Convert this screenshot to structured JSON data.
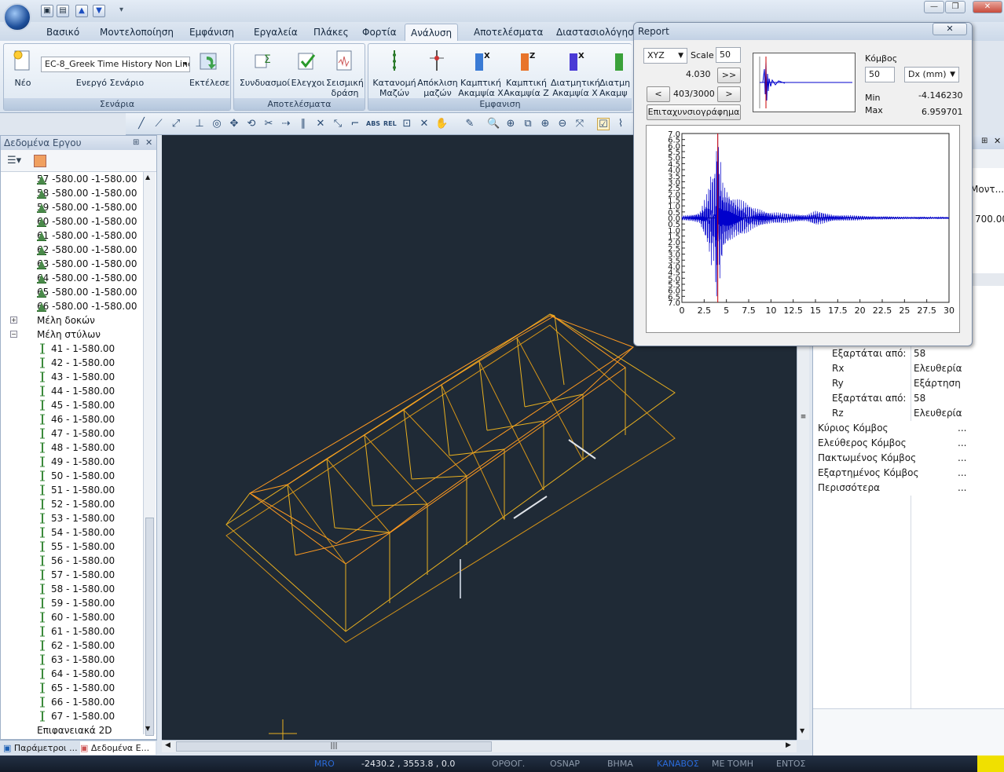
{
  "quick_access": {
    "icons": [
      "save-icon",
      "open-icon",
      "up-icon",
      "down-icon"
    ]
  },
  "window_controls": {
    "minimize": "—",
    "maximize": "❐",
    "close": "✕"
  },
  "tabs": [
    "Βασικό",
    "Μοντελοποίηση",
    "Εμφάνιση",
    "Εργαλεία",
    "Πλάκες",
    "Φορτία",
    "Ανάλυση",
    "Αποτελέσματα",
    "Διαστασιολόγηση"
  ],
  "active_tab": "Ανάλυση",
  "ribbon": {
    "scenario_group": {
      "caption": "Σενάρια",
      "new_label": "Νέο",
      "scenario_select": "EC-8_Greek Time History Non Line",
      "scenario_caption": "Ενεργό Σενάριο",
      "run_label": "Εκτέλεσε"
    },
    "results_group": {
      "caption": "Αποτελέσματα",
      "combos_label": "Συνδυασμοί",
      "checks_label": "Ελεγχοι",
      "seismic_label_1": "Σεισμική",
      "seismic_label_2": "δράση"
    },
    "display_group": {
      "caption": "Εμφανιση",
      "mass_dist_1": "Κατανομή",
      "mass_dist_2": "Μαζών",
      "mass_ecc_1": "Απόκλιση",
      "mass_ecc_2": "μαζών",
      "bend_x_1": "Καμπτική",
      "bend_x_2": "Ακαμψία X",
      "bend_z_1": "Καμπτική",
      "bend_z_2": "Ακαμψία Z",
      "shear_x_1": "Διατμητική",
      "shear_x_2": "Ακαμψία X",
      "shear_z_1": "Διατμη",
      "shear_z_2": "Ακαμψ"
    }
  },
  "left_panel": {
    "title": "Δεδομένα Εργου",
    "nodes": [
      "57 -580.00 -1-580.00",
      "58 -580.00 -1-580.00",
      "59 -580.00 -1-580.00",
      "60 -580.00 -1-580.00",
      "61 -580.00 -1-580.00",
      "62 -580.00 -1-580.00",
      "63 -580.00 -1-580.00",
      "64 -580.00 -1-580.00",
      "65 -580.00 -1-580.00",
      "66 -580.00 -1-580.00"
    ],
    "beams_label": "Μέλη δοκών",
    "columns_label": "Μέλη στύλων",
    "columns": [
      "41 - 1-580.00",
      "42 - 1-580.00",
      "43 - 1-580.00",
      "44 - 1-580.00",
      "45 - 1-580.00",
      "46 - 1-580.00",
      "47 - 1-580.00",
      "48 - 1-580.00",
      "49 - 1-580.00",
      "50 - 1-580.00",
      "51 - 1-580.00",
      "52 - 1-580.00",
      "53 - 1-580.00",
      "54 - 1-580.00",
      "55 - 1-580.00",
      "56 - 1-580.00",
      "57 - 1-580.00",
      "58 - 1-580.00",
      "59 - 1-580.00",
      "60 - 1-580.00",
      "61 - 1-580.00",
      "62 - 1-580.00",
      "63 - 1-580.00",
      "64 - 1-580.00",
      "65 - 1-580.00",
      "66 - 1-580.00",
      "67 - 1-580.00"
    ],
    "surfaces_label": "Επιφανειακά 2D"
  },
  "bottom_tabs": [
    "Παράμετροι ...",
    "Δεδομένα Ε..."
  ],
  "right_panel": {
    "partial_top_1": "Μοντ...",
    "partial_top_2": "700.00",
    "rows": [
      {
        "k": "Εξαρτάται από:",
        "v": "58",
        "indent": true
      },
      {
        "k": "Rx",
        "v": "Ελευθερία",
        "indent": true
      },
      {
        "k": "Ry",
        "v": "Εξάρτηση",
        "indent": true
      },
      {
        "k": "Εξαρτάται από:",
        "v": "58",
        "indent": true
      },
      {
        "k": "Rz",
        "v": "Ελευθερία",
        "indent": true
      },
      {
        "k": "Κύριος Κόμβος",
        "v": "...",
        "indent": false
      },
      {
        "k": "Ελεύθερος Κόμβος",
        "v": "...",
        "indent": false
      },
      {
        "k": "Πακτωμένος Κόμβος",
        "v": "...",
        "indent": false
      },
      {
        "k": "Εξαρτημένος Κόμβος",
        "v": "...",
        "indent": false
      },
      {
        "k": "Περισσότερα",
        "v": "...",
        "indent": false
      }
    ]
  },
  "report": {
    "title": "Report",
    "close": "✕",
    "mode_select": "XYZ",
    "scale_label": "Scale",
    "scale_value": "50",
    "time_value": "4.030",
    "fast_forward": ">>",
    "prev": "<",
    "next": ">",
    "step_display": "403/3000",
    "accel_button": "Επιταχυνσιογράφημα",
    "node_label": "Κόμβος",
    "node_value": "50",
    "dof_select": "Dx (mm)",
    "min_label": "Min",
    "min_value": "-4.146230",
    "max_label": "Max",
    "max_value": "6.959701"
  },
  "chart_data": {
    "type": "line",
    "title": "",
    "xlabel": "",
    "ylabel": "",
    "xlim": [
      0,
      30
    ],
    "ylim": [
      -7.0,
      7.0
    ],
    "x_ticks": [
      "0",
      "2.5",
      "5",
      "7.5",
      "10",
      "12.5",
      "15",
      "17.5",
      "20",
      "22.5",
      "25",
      "27.5",
      "30"
    ],
    "y_ticks_pos": [
      "7.0",
      "6.5",
      "6.0",
      "5.5",
      "5.0",
      "4.5",
      "4.0",
      "3.5",
      "3.0",
      "2.5",
      "2.0",
      "1.5",
      "1.0",
      "0.5",
      "0.0"
    ],
    "y_ticks_neg": [
      "0.5",
      "1.0",
      "1.5",
      "2.0",
      "2.5",
      "3.0",
      "3.5",
      "4.0",
      "4.5",
      "5.0",
      "5.5",
      "6.0",
      "6.5",
      "7.0"
    ],
    "cursor_x": 4.03,
    "series": [
      {
        "values_envelope": [
          [
            0,
            0.2
          ],
          [
            1,
            0.3
          ],
          [
            2,
            0.5
          ],
          [
            2.5,
            1.5
          ],
          [
            3,
            2.5
          ],
          [
            3.3,
            4.0
          ],
          [
            3.6,
            -3.5
          ],
          [
            3.9,
            -6.5
          ],
          [
            4.03,
            6.96
          ],
          [
            4.3,
            -5.5
          ],
          [
            4.6,
            3.2
          ],
          [
            5,
            -2.8
          ],
          [
            6,
            1.8
          ],
          [
            7,
            -1.4
          ],
          [
            8,
            0.9
          ],
          [
            9,
            -0.8
          ],
          [
            10,
            0.5
          ],
          [
            12,
            -0.4
          ],
          [
            14,
            0.3
          ],
          [
            15,
            0.6
          ],
          [
            17,
            -0.3
          ],
          [
            20,
            0.2
          ],
          [
            22,
            -0.15
          ],
          [
            25,
            0.1
          ],
          [
            27,
            -0.1
          ],
          [
            30,
            0.05
          ]
        ]
      }
    ],
    "line_color": "#0000cc",
    "cursor_color": "#cc0000"
  },
  "status": {
    "mode": "ΜRO",
    "coords": "-2430.2 , 3553.8 , 0.0",
    "ortho": "ΟΡΘΟΓ.",
    "osnap": "OSNAP",
    "step": "ΒΗΜΑ",
    "grid": "ΚΑΝΑΒΟΣ",
    "cut": "ΜΕ ΤΟΜΗ",
    "inside": "ΕΝΤΟΣ"
  },
  "colors": {
    "viewport": "#1f2a36",
    "frame": "#e8b020",
    "frame2": "#ff9a20"
  }
}
